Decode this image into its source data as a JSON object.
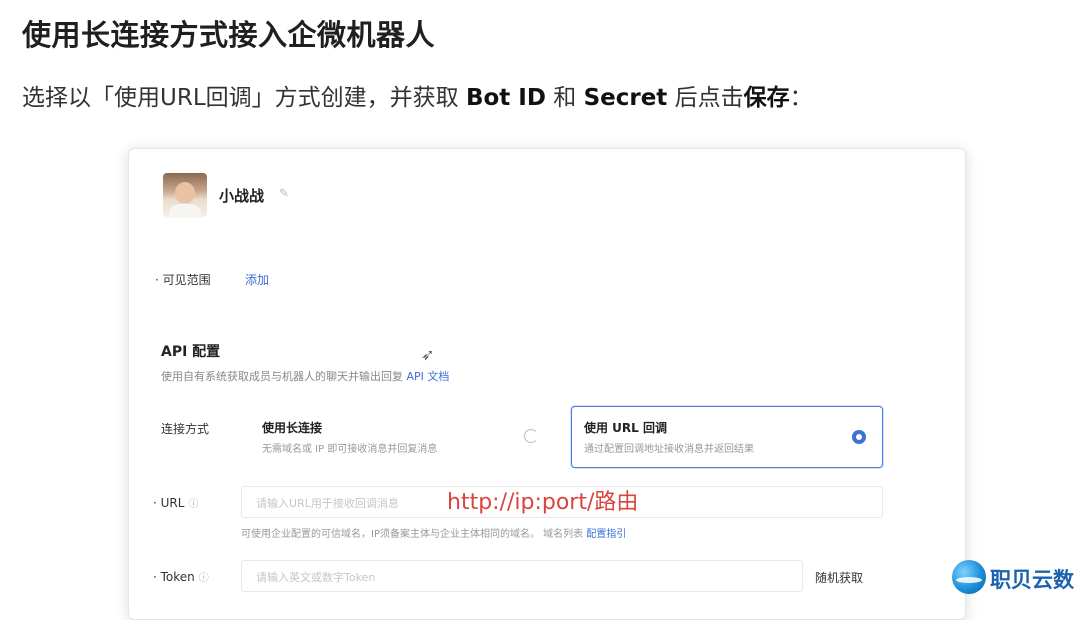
{
  "page": {
    "heading": "使用长连接方式接入企微机器人",
    "instruction_parts": [
      "选择以「使用URL回调」方式创建，并获取 ",
      "Bot ID",
      " 和 ",
      "Secret",
      " 后点击",
      "保存",
      "："
    ]
  },
  "bot": {
    "name": "小战战"
  },
  "visibility": {
    "label": "可见范围",
    "action": "添加"
  },
  "api": {
    "title": "API 配置",
    "desc": "使用自有系统获取成员与机器人的聊天并输出回复",
    "doc_link": "API 文档"
  },
  "connection": {
    "label": "连接方式",
    "options": [
      {
        "title": "使用长连接",
        "desc": "无需域名或 IP 即可接收消息并回复消息",
        "selected": false
      },
      {
        "title": "使用 URL 回调",
        "desc": "通过配置回调地址接收消息并返回结果",
        "selected": true
      }
    ]
  },
  "url_field": {
    "label": "URL",
    "placeholder": "请输入URL用于接收回调消息",
    "annotation": "http://ip:port/路由",
    "hint": "可使用企业配置的可信域名，IP须备案主体与企业主体相同的域名。",
    "hint_link1": "域名列表",
    "hint_link2": "配置指引"
  },
  "token_field": {
    "label": "Token",
    "placeholder": "请输入英文或数字Token",
    "button": "随机获取"
  },
  "watermark": {
    "text": "职贝云数"
  },
  "colors": {
    "accent": "#3d6fd6",
    "annotation": "#d9453d",
    "brand": "#1b63b0"
  }
}
